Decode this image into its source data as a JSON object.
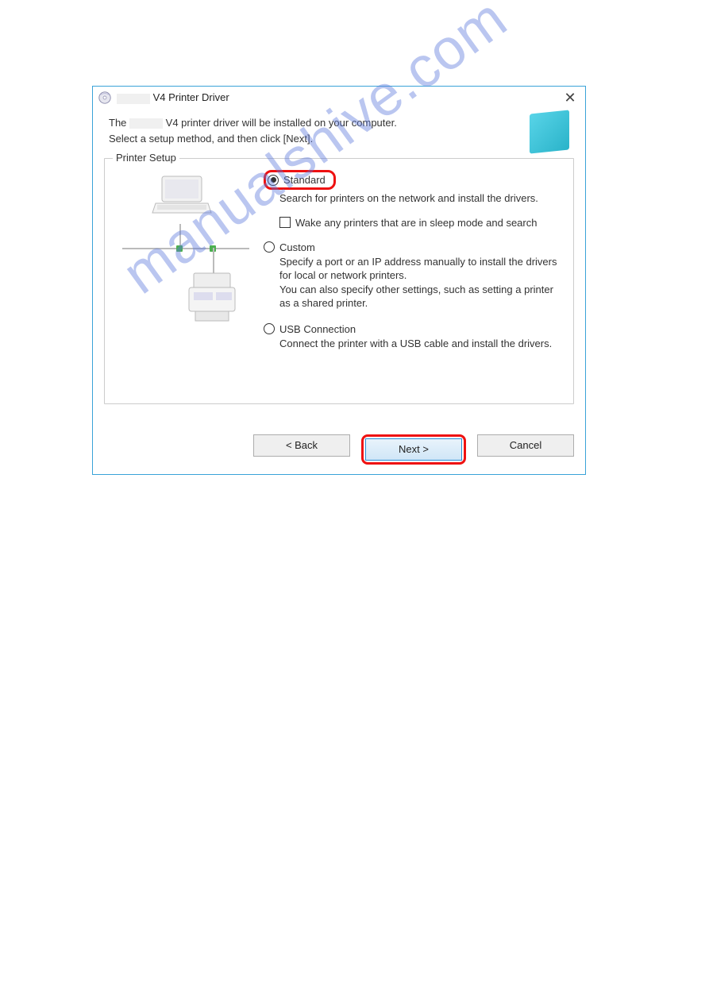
{
  "watermark": "manualshive.com",
  "dialog": {
    "title_suffix": "V4 Printer Driver",
    "close_glyph": "✕",
    "intro_line1_prefix": "The",
    "intro_line1_suffix": "V4 printer driver will be installed on your computer.",
    "intro_line2": "Select a setup method, and then click [Next].",
    "group_legend": "Printer Setup",
    "standard": {
      "label": "Standard",
      "desc": "Search for printers on the network and install the drivers.",
      "checkbox": "Wake any printers that are in sleep mode and search"
    },
    "custom": {
      "label": "Custom",
      "desc": "Specify a port or an IP address manually to install the drivers for local or network printers.\nYou can also specify other settings, such as setting a printer as a shared printer."
    },
    "usb": {
      "label": "USB Connection",
      "desc": "Connect the printer with a USB cable and install the drivers."
    },
    "buttons": {
      "back": "< Back",
      "next": "Next >",
      "cancel": "Cancel"
    }
  }
}
